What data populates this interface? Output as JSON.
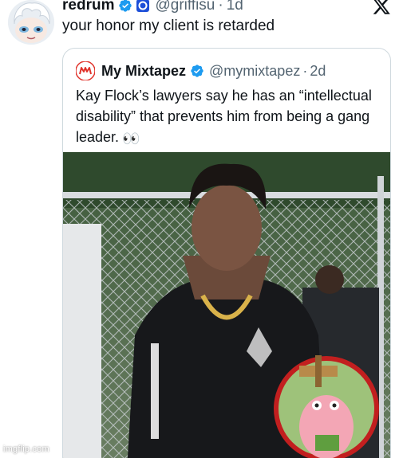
{
  "tweet": {
    "display_name": "redrum",
    "handle": "@griffisu",
    "separator": "·",
    "time": "1d",
    "text": "your honor my client is retarded"
  },
  "quoted": {
    "display_name": "My Mixtapez",
    "handle": "@mymixtapez",
    "separator": "·",
    "time": "2d",
    "text": "Kay Flock’s lawyers say he has an “intellectual disability” that prevents him from being a gang leader.",
    "emoji": "👀"
  },
  "watermark": "imgflip.com",
  "colors": {
    "verified_blue": "#1d9bf0",
    "muted_text": "#536471",
    "border": "#cfd9de",
    "mixtapez_red": "#e0332b"
  },
  "icons": {
    "brand": "x-logo-icon",
    "verified": "verified-badge-icon",
    "affiliate": "affiliate-badge-icon"
  }
}
